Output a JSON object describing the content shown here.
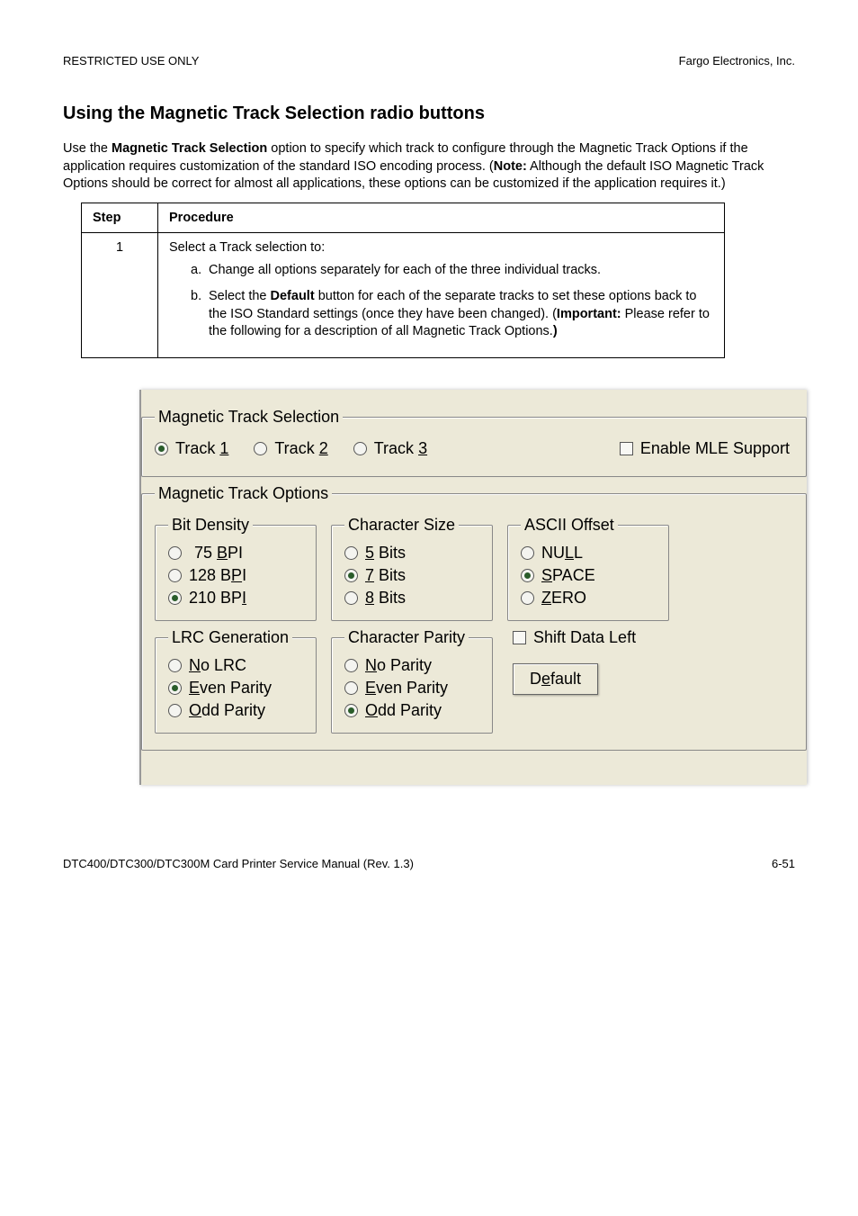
{
  "header": {
    "left": "RESTRICTED USE ONLY",
    "right": "Fargo Electronics, Inc."
  },
  "section": {
    "title": "Using the Magnetic Track Selection radio buttons",
    "intro_pre": "Use the ",
    "intro_b1": "Magnetic Track Selection",
    "intro_mid1": " option to specify which track to configure through the Magnetic Track Options if the application requires customization of the standard ISO encoding process. (",
    "intro_b2": "Note:",
    "intro_mid2": "  Although the default ISO Magnetic Track Options should be correct for almost all applications, these options can be customized if the application requires it.)"
  },
  "table": {
    "h_step": "Step",
    "h_proc": "Procedure",
    "step_num": "1",
    "proc_intro": "Select a Track selection to:",
    "a_marker": "a.",
    "a_text": "Change all options separately for each of the three individual tracks.",
    "b_marker": "b.",
    "b_pre": "Select the ",
    "b_bold": "Default",
    "b_mid": " button for each of the separate tracks to set these options back to the ISO Standard settings (once they have been changed). (",
    "b_bold2": "Important:",
    "b_post": "  Please refer to the following for a description of all Magnetic Track Options.",
    "b_close": ")"
  },
  "dialog": {
    "mts_legend": "Magnetic Track Selection",
    "track1_u": "1",
    "track1_pre": "Track ",
    "track2_u": "2",
    "track2_pre": "Track ",
    "track3_u": "3",
    "track3_pre": "Track ",
    "mle": "Enable MLE Support",
    "mto_legend": "Magnetic Track Options",
    "bitdensity": {
      "legend": "Bit Density",
      "o1_pre": "75 ",
      "o1_u": "B",
      "o1_post": "PI",
      "o2_pre": "128 B",
      "o2_u": "P",
      "o2_post": "I",
      "o3_pre": "210 BP",
      "o3_u": "I",
      "o3_post": ""
    },
    "charsize": {
      "legend": "Character Size",
      "o1_u": "5",
      "o1_post": " Bits",
      "o2_u": "7",
      "o2_post": " Bits",
      "o3_u": "8",
      "o3_post": " Bits"
    },
    "ascii": {
      "legend": "ASCII Offset",
      "o1_pre": "NU",
      "o1_u": "L",
      "o1_post": "L",
      "o2_u": "S",
      "o2_post": "PACE",
      "o3_u": "Z",
      "o3_post": "ERO"
    },
    "lrc": {
      "legend": "LRC Generation",
      "o1_u": "N",
      "o1_post": "o LRC",
      "o2_u": "E",
      "o2_post": "ven Parity",
      "o3_u": "O",
      "o3_post": "dd Parity"
    },
    "charparity": {
      "legend": "Character Parity",
      "o1_u": "N",
      "o1_post": "o Parity",
      "o2_u": "E",
      "o2_post": "ven Parity",
      "o3_u": "O",
      "o3_post": "dd Parity"
    },
    "shift": "Shift Data Left",
    "default_pre": "D",
    "default_u": "e",
    "default_post": "fault"
  },
  "footer": {
    "left": "DTC400/DTC300/DTC300M Card Printer Service Manual (Rev. 1.3)",
    "right": "6-51"
  }
}
